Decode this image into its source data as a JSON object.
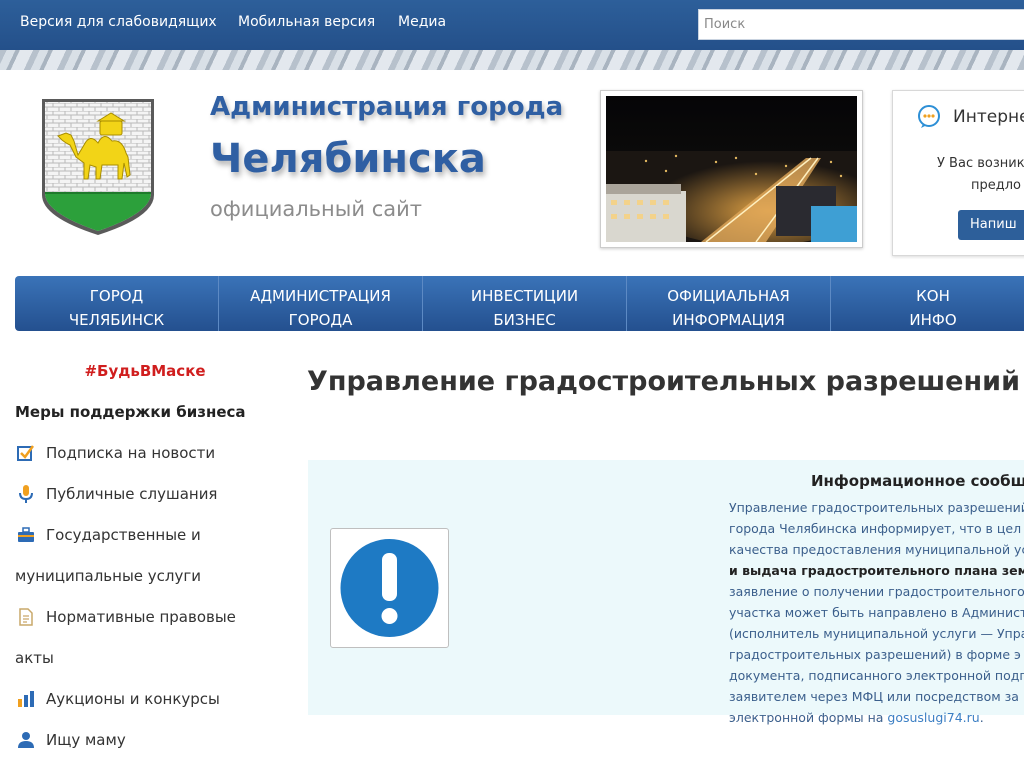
{
  "topbar": {
    "links": [
      "Версия для слабовидящих",
      "Мобильная версия",
      "Медиа"
    ],
    "search_placeholder": "Поиск"
  },
  "header": {
    "title_line1": "Администрация города",
    "title_line2": "Челябинска",
    "subtitle": "официальный сайт"
  },
  "reception": {
    "title": "Интерне",
    "text_line1": "У Вас возник",
    "text_line2": "предло",
    "button": "Напиш"
  },
  "nav": {
    "items": [
      {
        "line1": "ГОРОД",
        "line2": "ЧЕЛЯБИНСК"
      },
      {
        "line1": "АДМИНИСТРАЦИЯ",
        "line2": "ГОРОДА"
      },
      {
        "line1": "ИНВЕСТИЦИИ",
        "line2": "БИЗНЕС"
      },
      {
        "line1": "ОФИЦИАЛЬНАЯ",
        "line2": "ИНФОРМАЦИЯ"
      },
      {
        "line1": "КОН",
        "line2": "ИНФО"
      }
    ]
  },
  "sidebar": {
    "hashtag": "#БудьВМаске",
    "bold_link": "Меры поддержки бизнеса",
    "items": [
      {
        "label": "Подписка на новости",
        "icon": "checkbox-icon"
      },
      {
        "label": "Публичные слушания",
        "icon": "microphone-icon"
      },
      {
        "label": "Государственные и",
        "label2": "муниципальные услуги",
        "icon": "toolbox-icon"
      },
      {
        "label": "Нормативные правовые",
        "label2": "акты",
        "icon": "document-icon"
      },
      {
        "label": "Аукционы и конкурсы",
        "icon": "bar-chart-icon"
      },
      {
        "label": "Ищу маму",
        "icon": "person-icon"
      }
    ]
  },
  "main": {
    "page_title": "Управление градостроительных разрешений",
    "info": {
      "heading": "Информационное сообщ",
      "lines": [
        "Управление градостроительных разрешений",
        "города Челябинска информирует, что в цел",
        "качества предоставления муниципальной ус",
        "и выдача градостроительного плана земель",
        "заявление о получении градостроительного п",
        "участка может быть направлено в Админист",
        "(исполнитель муниципальной услуги — Упра",
        "градостроительных разрешений) в форме э",
        "документа, подписанного электронной подп",
        "заявителем через МФЦ или посредством за"
      ],
      "last_prefix": "электронной формы на ",
      "last_link": "gosuslugi74.ru",
      "last_suffix": "."
    }
  },
  "colors": {
    "brand_blue": "#2f5fa3",
    "nav_blue": "#2d5f9a",
    "hashtag_red": "#d01e1e",
    "info_bg": "#ecf9fb"
  }
}
